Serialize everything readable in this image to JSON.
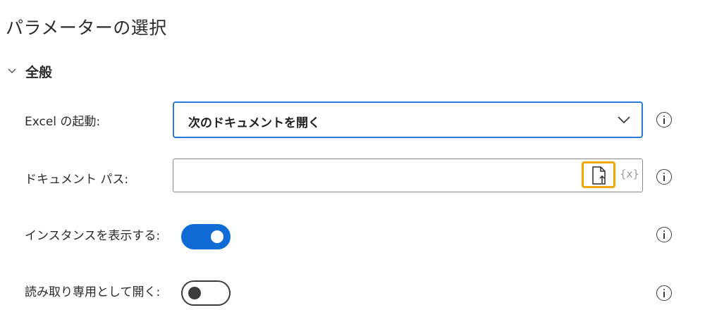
{
  "header": {
    "title": "パラメーターの選択"
  },
  "section": {
    "label": "全般",
    "expanded": true,
    "icon": "chevron-down-icon"
  },
  "fields": {
    "launch_excel": {
      "label": "Excel の起動:",
      "value": "次のドキュメントを開く",
      "icon": "chevron-down-icon"
    },
    "document_path": {
      "label": "ドキュメント パス:",
      "value": "",
      "file_button_icon": "file-select-icon",
      "variable_button_label": "{x}"
    },
    "show_instance": {
      "label": "インスタンスを表示する:",
      "checked": true
    },
    "read_only": {
      "label": "読み取り専用として開く:",
      "checked": false
    }
  },
  "info_icon": "info-icon",
  "colors": {
    "accent": "#0f6cd6",
    "select_border": "#2b7bd8",
    "focus_highlight": "#f0a800"
  }
}
